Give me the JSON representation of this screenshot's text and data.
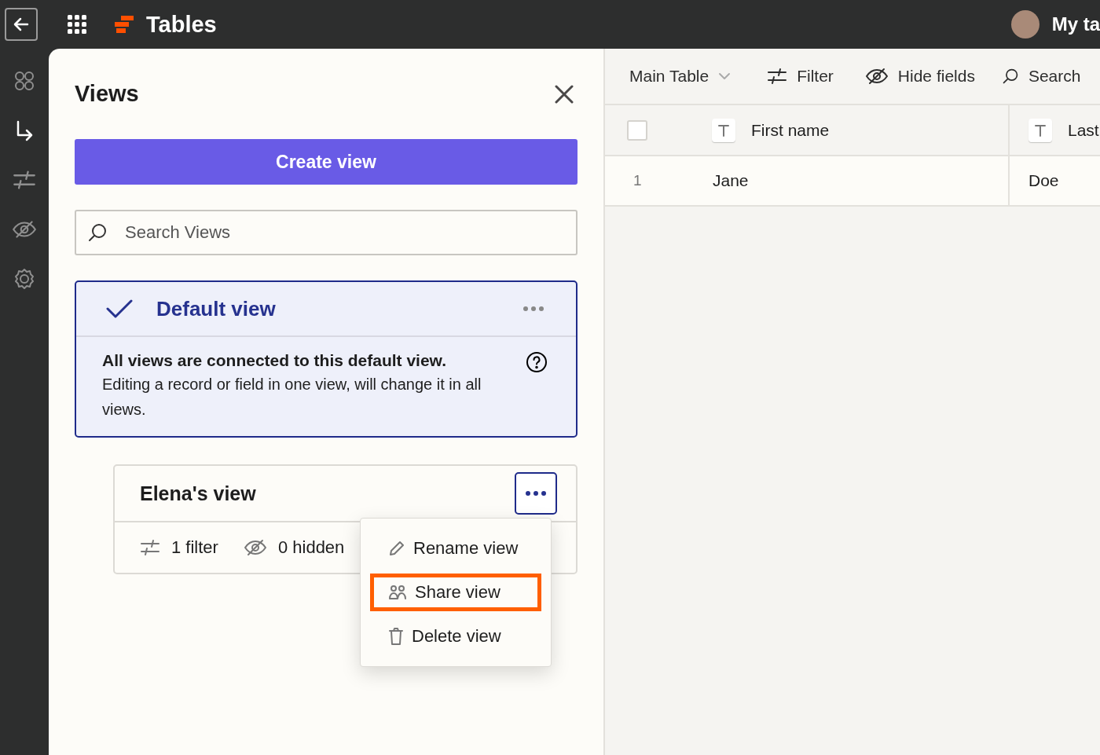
{
  "top_bar": {
    "app_name": "Tables",
    "user_label": "My ta"
  },
  "rail": {
    "items": [
      {
        "kind": "apps",
        "selected": false
      },
      {
        "kind": "redirect",
        "selected": true
      },
      {
        "kind": "filter",
        "selected": false
      },
      {
        "kind": "hide",
        "selected": false
      },
      {
        "kind": "settings",
        "selected": false
      }
    ]
  },
  "views_panel": {
    "title": "Views",
    "create_button": "Create view",
    "search": {
      "placeholder": "Search Views"
    },
    "default_view": {
      "name": "Default view",
      "selected": true,
      "note_title": "All views are connected to this default view.",
      "note_body": "Editing a record or field in one view, will change it in all views."
    },
    "views": [
      {
        "name": "Elena's view",
        "menu_open": true,
        "filter_count": "1 filter",
        "hidden_count": "0 hidden"
      }
    ],
    "menu": {
      "items": [
        {
          "kind": "rename",
          "label": "Rename view",
          "highlighted": false
        },
        {
          "kind": "share",
          "label": "Share view",
          "highlighted": true
        },
        {
          "kind": "delete",
          "label": "Delete view",
          "highlighted": false
        }
      ]
    }
  },
  "table": {
    "select_all_checked": false,
    "toolbar": {
      "table_name": "Main Table",
      "filter": "Filter",
      "hide_fields": "Hide fields",
      "search": "Search"
    },
    "columns": [
      {
        "label": "First name"
      },
      {
        "label": "Last"
      }
    ],
    "rows": [
      {
        "number": "1",
        "checked": false,
        "cells": [
          "Jane",
          "Doe"
        ]
      }
    ]
  }
}
